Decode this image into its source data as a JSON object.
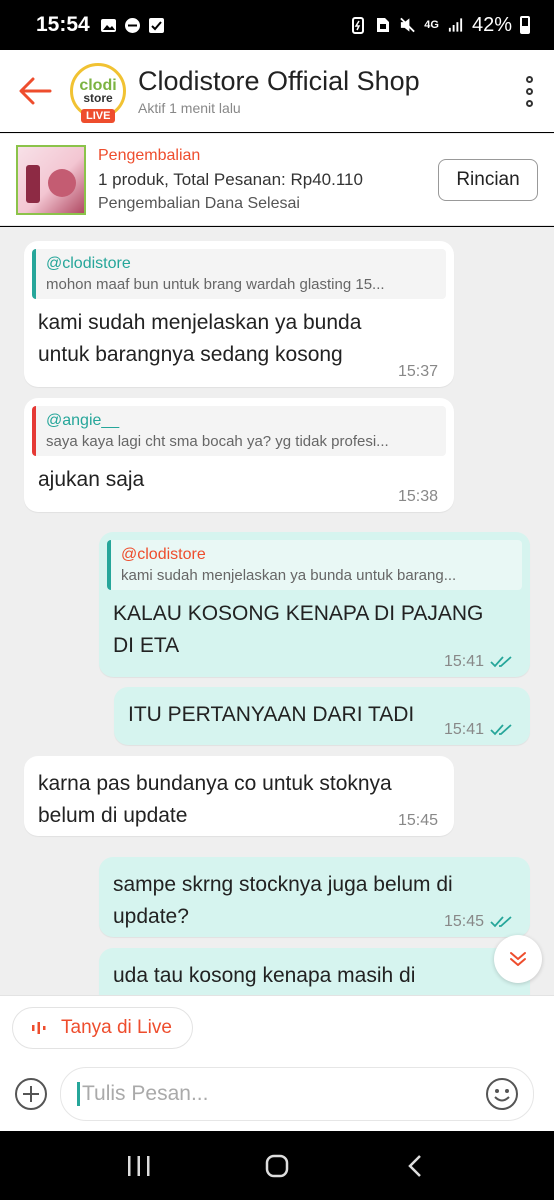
{
  "status_bar": {
    "time": "15:54",
    "network": "4G",
    "battery": "42%"
  },
  "header": {
    "title": "Clodistore Official Shop",
    "subtitle": "Aktif 1 menit lalu",
    "logo_line1": "clodi",
    "logo_line2": "store",
    "live_badge": "LIVE"
  },
  "order": {
    "status": "Pengembalian",
    "summary": "1 produk, Total Pesanan: Rp40.110",
    "refund_status": "Pengembalian Dana Selesai",
    "details_button": "Rincian"
  },
  "messages": [
    {
      "side": "in",
      "quote_name": "@clodistore",
      "quote_text": "mohon maaf bun untuk brang wardah glasting 15...",
      "text": "kami sudah menjelaskan ya bunda untuk barangnya sedang kosong",
      "time": "15:37"
    },
    {
      "side": "in",
      "quote_name": "@angie__",
      "quote_text": "saya kaya lagi cht sma bocah ya? yg tidak profesi...",
      "text": "ajukan saja",
      "time": "15:38"
    },
    {
      "side": "out",
      "quote_name": "@clodistore",
      "quote_text": "kami sudah menjelaskan ya bunda untuk barang...",
      "text": "KALAU KOSONG KENAPA DI PAJANG DI ETA",
      "time": "15:41"
    },
    {
      "side": "out",
      "text": "ITU PERTANYAAN DARI  TADI",
      "time": "15:41"
    },
    {
      "side": "in",
      "text": "karna pas bundanya co untuk stoknya belum di update",
      "time": "15:45"
    },
    {
      "side": "out",
      "text": "sampe skrng stocknya juga belum di update?",
      "time": "15:45"
    },
    {
      "side": "out",
      "text": "uda tau kosong kenapa masih di",
      "time": ""
    }
  ],
  "live_button": "Tanya di Live",
  "composer": {
    "placeholder": "Tulis Pesan..."
  },
  "colors": {
    "accent": "#ee4d2d",
    "teal": "#26a69a",
    "out_bubble": "#d6f4ef",
    "chat_bg": "#efefef"
  }
}
